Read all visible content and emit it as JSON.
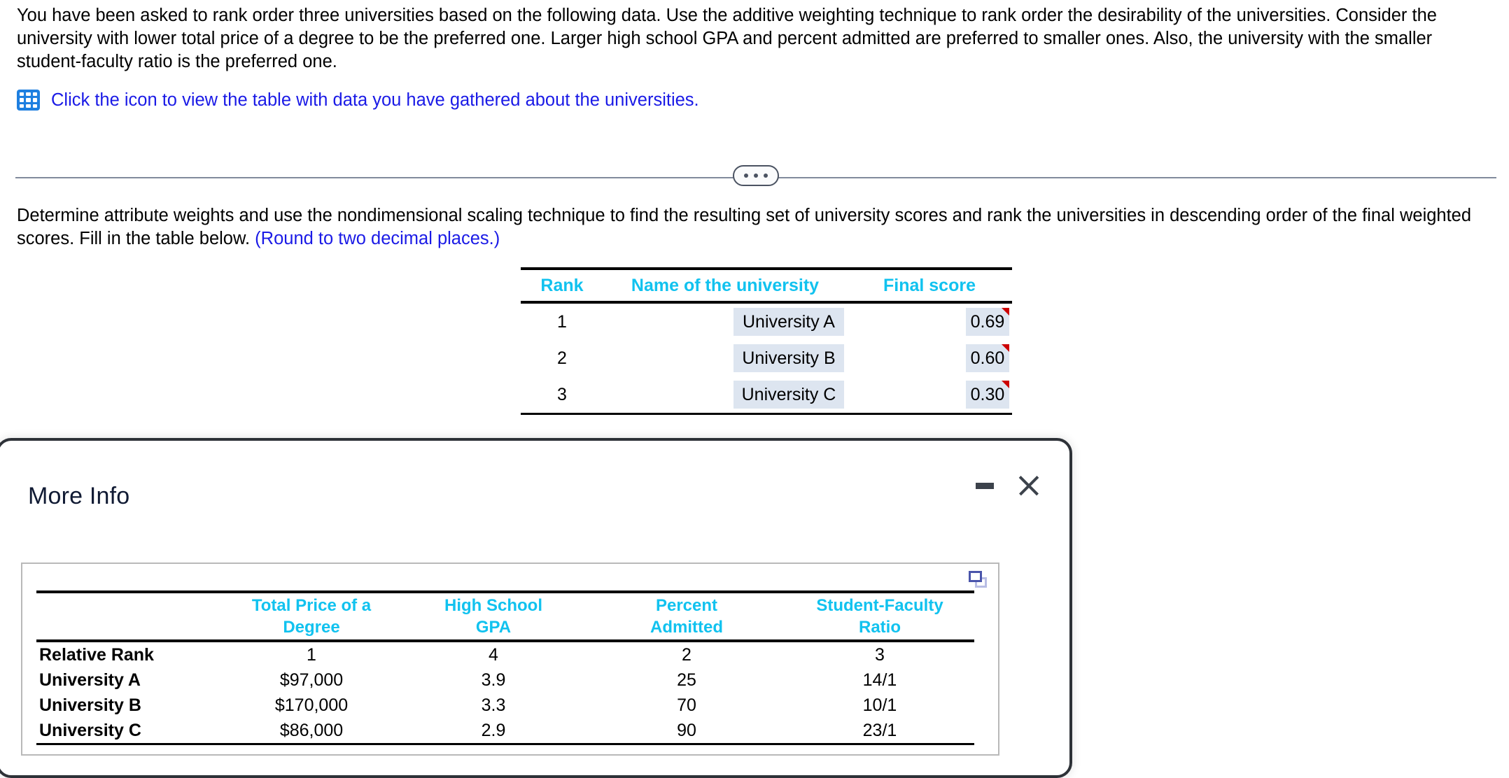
{
  "problem": {
    "statement": "You have been asked to rank order three universities based on the following data. Use the additive weighting technique to rank order the desirability of the universities. Consider the university with lower total price of a degree to be the preferred one. Larger high school GPA and percent admitted are preferred to smaller ones. Also, the university with the smaller student-faculty ratio is the preferred one.",
    "icon_link_text": "Click the icon to view the table with data you have gathered about the universities.",
    "icon_name": "table-grid-icon",
    "link_color": "#1a1ae6"
  },
  "divider": {
    "dots_label": "•••"
  },
  "instruction": {
    "main": "Determine attribute weights and use the nondimensional scaling technique to find the resulting set of university scores and rank the universities in descending order of the final weighted scores. Fill in the table below. ",
    "note": "(Round to two decimal places.)"
  },
  "answer_table": {
    "headers": [
      "Rank",
      "Name of the university",
      "Final score"
    ],
    "header_color": "#11c2ef",
    "rows": [
      {
        "rank": "1",
        "name": "University A",
        "score": "0.69"
      },
      {
        "rank": "2",
        "name": "University B",
        "score": "0.60"
      },
      {
        "rank": "3",
        "name": "University C",
        "score": "0.30"
      }
    ]
  },
  "more_info": {
    "title": "More Info",
    "minimize_label": "Minimize",
    "close_label": "Close",
    "copy_icon_name": "copy-window-icon",
    "data_table": {
      "headers": [
        "",
        "Total Price of a Degree",
        "High School GPA",
        "Percent Admitted",
        "Student-Faculty Ratio"
      ],
      "header_lines": [
        [
          "",
          ""
        ],
        [
          "Total Price of a",
          "Degree"
        ],
        [
          "High School",
          "GPA"
        ],
        [
          "Percent",
          "Admitted"
        ],
        [
          "Student-Faculty",
          "Ratio"
        ]
      ],
      "header_color": "#11c2ef",
      "rows": [
        {
          "label": "Relative Rank",
          "price": "1",
          "gpa": "4",
          "admitted": "2",
          "ratio": "3"
        },
        {
          "label": "University A",
          "price": "$97,000",
          "gpa": "3.9",
          "admitted": "25",
          "ratio": "14/1"
        },
        {
          "label": "University B",
          "price": "$170,000",
          "gpa": "3.3",
          "admitted": "70",
          "ratio": "10/1"
        },
        {
          "label": "University C",
          "price": "$86,000",
          "gpa": "2.9",
          "admitted": "90",
          "ratio": "23/1"
        }
      ]
    }
  }
}
